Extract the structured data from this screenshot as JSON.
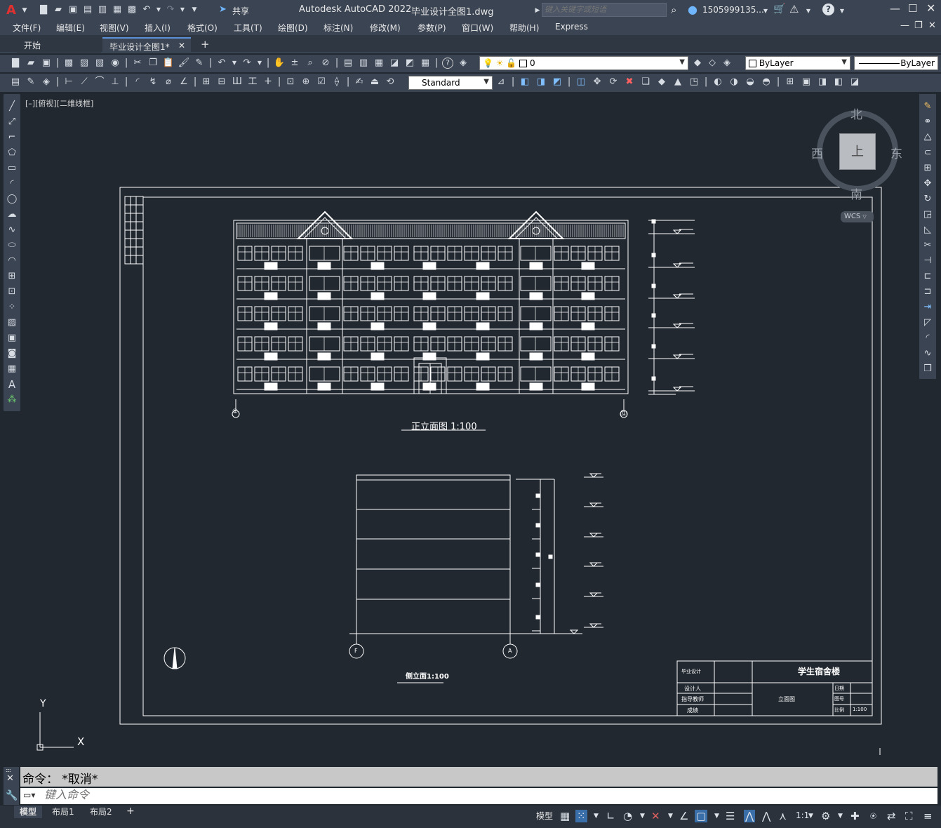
{
  "app": {
    "title": "Autodesk AutoCAD 2022",
    "file": "毕业设计全图1.dwg",
    "share": "共享",
    "search_placeholder": "键入关键字或短语",
    "user": "1505999135...",
    "help": "?"
  },
  "menu": [
    "文件(F)",
    "编辑(E)",
    "视图(V)",
    "插入(I)",
    "格式(O)",
    "工具(T)",
    "绘图(D)",
    "标注(N)",
    "修改(M)",
    "参数(P)",
    "窗口(W)",
    "帮助(H)",
    "Express"
  ],
  "tabs": {
    "start": "开始",
    "active": "毕业设计全图1*",
    "add": "+"
  },
  "layers": {
    "current": "0",
    "color": "ByLayer",
    "linetype": "ByLayer",
    "text_style": "Standard"
  },
  "viewport": {
    "label": "[–][俯视][二维线框]"
  },
  "viewcube": {
    "north": "北",
    "south": "南",
    "east": "东",
    "west": "西",
    "face": "上",
    "wcs": "WCS"
  },
  "drawing": {
    "front_title": "正立面图 1:100",
    "side_title": "侧立面1:100",
    "grid_left": "①",
    "grid_right": "⑫",
    "grid_f": "F",
    "grid_a": "A",
    "titleblock": {
      "project": "学生宿舍楼",
      "school": "毕业设计",
      "designer": "设计人",
      "advisor": "指导教师",
      "grade": "成绩",
      "drawing_name": "立面图",
      "date_label": "日期",
      "sheet_label": "图号",
      "scale_label": "比例",
      "scale_value": "1:100"
    }
  },
  "ucs": {
    "x": "X",
    "y": "Y"
  },
  "command": {
    "history": "命令：  *取消*",
    "placeholder": "键入命令"
  },
  "layout_tabs": [
    "模型",
    "布局1",
    "布局2"
  ],
  "status": {
    "model": "模型",
    "scale": "1:1"
  }
}
